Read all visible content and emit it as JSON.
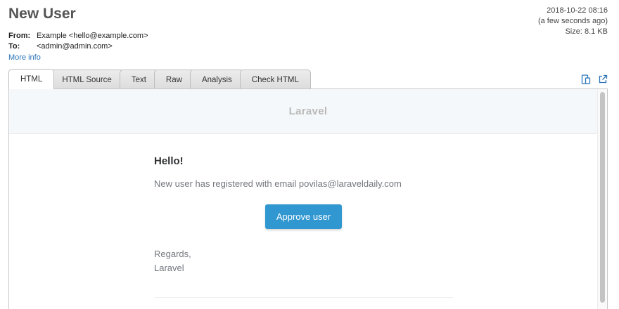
{
  "message": {
    "subject": "New User",
    "from_label": "From:",
    "from_value": "Example <hello@example.com>",
    "to_label": "To:",
    "to_value": "<admin@admin.com>",
    "more_info": "More info",
    "date": "2018-10-22 08:16",
    "relative_time": "(a few seconds ago)",
    "size": "Size: 8.1 KB"
  },
  "tabs": [
    {
      "label": "HTML",
      "active": true
    },
    {
      "label": "HTML Source",
      "active": false
    },
    {
      "label": "Text",
      "active": false
    },
    {
      "label": "Raw",
      "active": false
    },
    {
      "label": "Analysis",
      "active": false
    },
    {
      "label": "Check HTML",
      "active": false
    }
  ],
  "toolbar_icons": [
    "device-icon",
    "external-link-icon"
  ],
  "email": {
    "brand": "Laravel",
    "greeting": "Hello!",
    "line": "New user has registered with email povilas@laraveldaily.com",
    "button_label": "Approve user",
    "regards": "Regards,",
    "signature": "Laravel"
  },
  "colors": {
    "accent": "#3097d1",
    "link": "#2a74b8"
  }
}
